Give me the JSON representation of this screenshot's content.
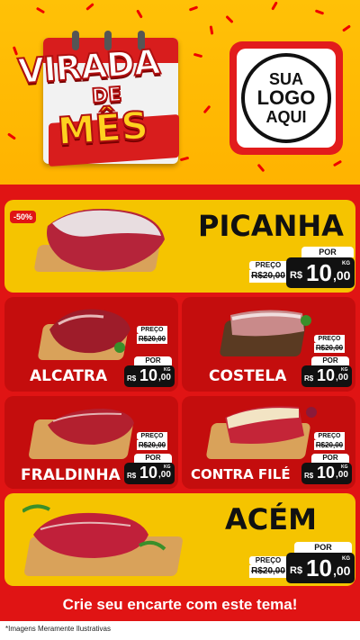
{
  "header": {
    "title_line1": "VIRADA",
    "title_line2": "DE",
    "title_line3": "MÊS",
    "logo_line1": "SUA",
    "logo_line2": "LOGO",
    "logo_line3": "AQUI"
  },
  "products": {
    "picanha": {
      "name": "PICANHA",
      "discount": "-50%",
      "preco": "PREÇO",
      "old_price": "R$20,00",
      "por": "POR",
      "currency": "R$",
      "price_int": "10",
      "price_dec": ",00",
      "unit": "KG"
    },
    "alcatra": {
      "name": "ALCATRA",
      "preco": "PREÇO",
      "old_price": "R$20,00",
      "por": "POR",
      "currency": "R$",
      "price_int": "10",
      "price_dec": ",00",
      "unit": "KG"
    },
    "costela": {
      "name": "COSTELA",
      "preco": "PREÇO",
      "old_price": "R$20,00",
      "por": "POR",
      "currency": "R$",
      "price_int": "10",
      "price_dec": ",00",
      "unit": "KG"
    },
    "fraldinha": {
      "name": "FRALDINHA",
      "preco": "PREÇO",
      "old_price": "R$20,00",
      "por": "POR",
      "currency": "R$",
      "price_int": "10",
      "price_dec": ",00",
      "unit": "KG"
    },
    "contrafile": {
      "name": "CONTRA FILÉ",
      "preco": "PREÇO",
      "old_price": "R$20,00",
      "por": "POR",
      "currency": "R$",
      "price_int": "10",
      "price_dec": ",00",
      "unit": "KG"
    },
    "acem": {
      "name": "ACÉM",
      "preco": "PREÇO",
      "old_price": "R$20,00",
      "por": "POR",
      "currency": "R$",
      "price_int": "10",
      "price_dec": ",00",
      "unit": "KG"
    }
  },
  "cta": {
    "label": "Crie seu encarte com este tema!"
  },
  "footer": {
    "disclaimer": "*Imagens Meramente Ilustrativas"
  },
  "colors": {
    "brand_red": "#e01414",
    "dark_red": "#c40d0d",
    "yellow": "#f5c400",
    "price_black": "#111111"
  }
}
